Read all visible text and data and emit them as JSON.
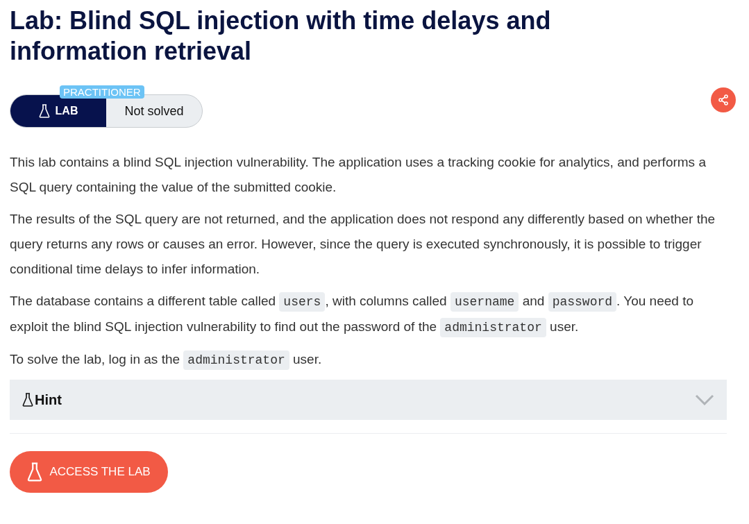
{
  "title": "Lab: Blind SQL injection with time delays and information retrieval",
  "level_badge": "PRACTITIONER",
  "lab_label": "LAB",
  "status": "Not solved",
  "paragraphs": [
    [
      {
        "kind": "text",
        "text": "This lab contains a blind SQL injection vulnerability. The application uses a tracking cookie for analytics, and performs a SQL query containing the value of the submitted cookie."
      }
    ],
    [
      {
        "kind": "text",
        "text": "The results of the SQL query are not returned, and the application does not respond any differently based on whether the query returns any rows or causes an error. However, since the query is executed synchronously, it is possible to trigger conditional time delays to infer information."
      }
    ],
    [
      {
        "kind": "text",
        "text": "The database contains a different table called "
      },
      {
        "kind": "code",
        "text": "users"
      },
      {
        "kind": "text",
        "text": ", with columns called "
      },
      {
        "kind": "code",
        "text": "username"
      },
      {
        "kind": "text",
        "text": " and "
      },
      {
        "kind": "code",
        "text": "password"
      },
      {
        "kind": "text",
        "text": ". You need to exploit the blind SQL injection vulnerability to find out the password of the "
      },
      {
        "kind": "code",
        "text": "administrator"
      },
      {
        "kind": "text",
        "text": " user."
      }
    ],
    [
      {
        "kind": "text",
        "text": "To solve the lab, log in as the "
      },
      {
        "kind": "code",
        "text": "administrator"
      },
      {
        "kind": "text",
        "text": " user."
      }
    ]
  ],
  "hint": {
    "label": "Hint",
    "expanded": false
  },
  "access_button": "ACCESS THE LAB"
}
